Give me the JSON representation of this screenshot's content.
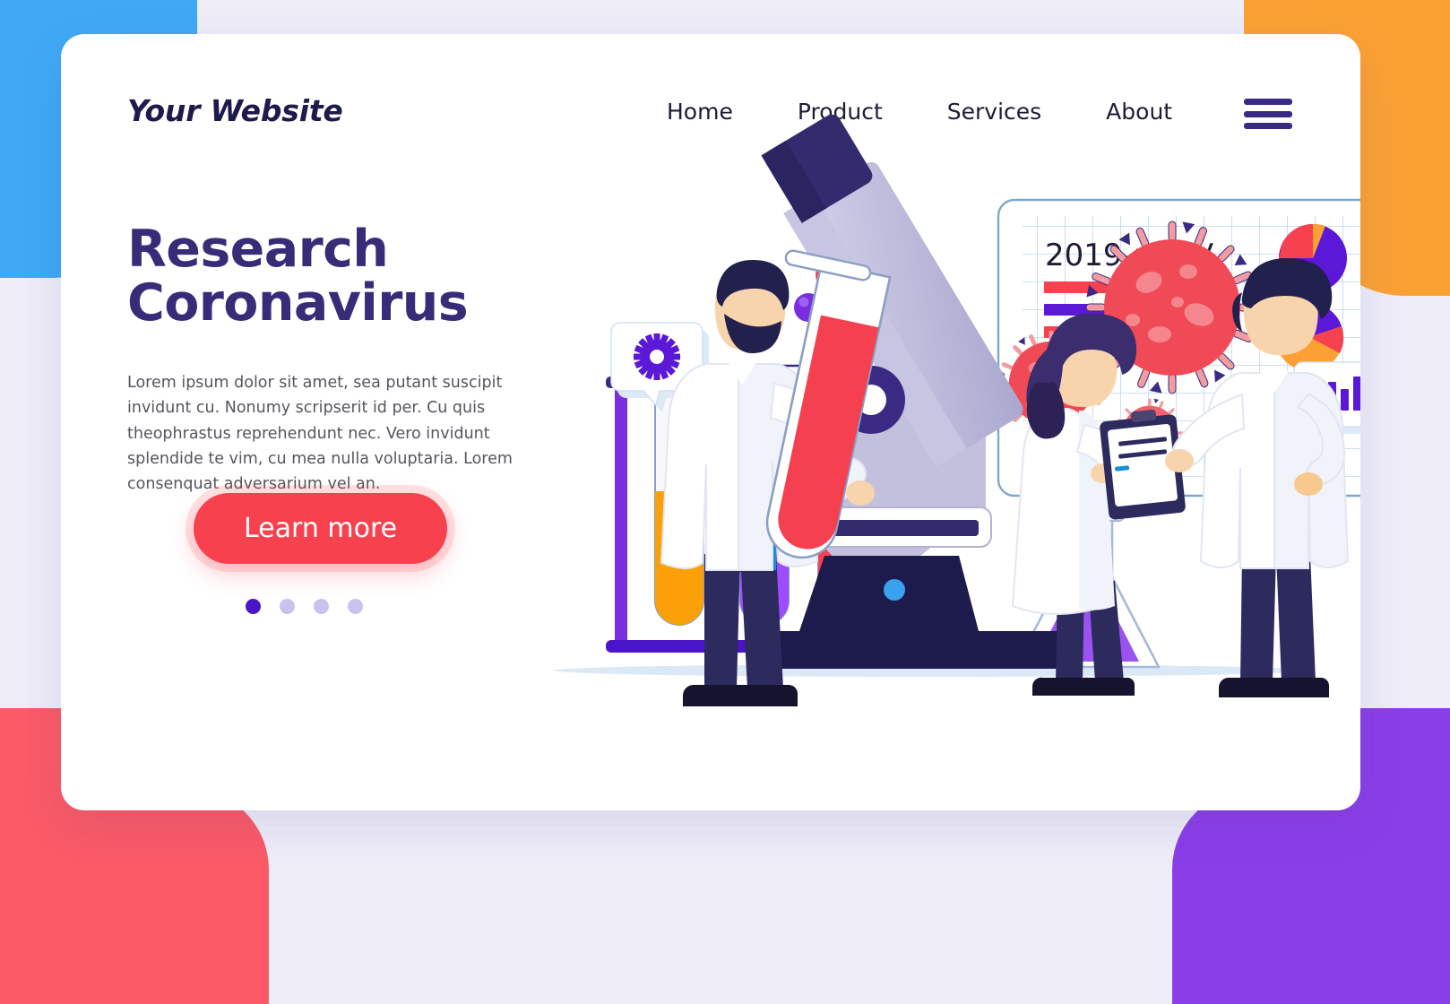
{
  "page": {
    "background_color": "#eeedf8",
    "card_color": "#ffffff"
  },
  "decor": {
    "top_left_color": "#3fa9f5",
    "top_right_color": "#fba134",
    "bottom_left_color": "#fb5a66",
    "bottom_right_color": "#8a3ee8"
  },
  "header": {
    "logo": "Your Website",
    "nav": [
      {
        "label": "Home"
      },
      {
        "label": "Product"
      },
      {
        "label": "Services"
      },
      {
        "label": "About"
      }
    ],
    "menu_icon": "hamburger-menu-icon",
    "menu_color": "#3a2a83"
  },
  "hero": {
    "title_line1": "Research",
    "title_line2": "Coronavirus",
    "title_color": "#382c79",
    "body": "Lorem ipsum dolor sit amet, sea putant suscipit invidunt cu. Nonumy scripserit id per. Cu quis theophrastus reprehendunt nec. Vero invidunt splendide te vim, cu mea nulla voluptaria. Lorem consenquat adversarium vel an.",
    "cta_label": "Learn more",
    "cta_color": "#f8414f",
    "carousel": {
      "count": 4,
      "active_index": 0,
      "active_color": "#4a14c8",
      "inactive_color": "#c9c2ef"
    }
  },
  "illustration": {
    "name": "coronavirus-research-lab-illustration",
    "board": {
      "title": "2019-nCoV",
      "title_color": "#1d1b35",
      "grid_color": "#bcd6ef",
      "bars": [
        {
          "color": "#f8414f",
          "length": 200
        },
        {
          "color": "#5b18d6",
          "length": 160
        },
        {
          "color": "#f8414f",
          "length": 88
        },
        {
          "color": "#5b18d6",
          "length": 130
        }
      ],
      "pie_charts": [
        {
          "name": "pie-chart-top",
          "slices": [
            {
              "color": "#5b18d6",
              "value": 58
            },
            {
              "color": "#f8414f",
              "value": 30
            },
            {
              "color": "#fba134",
              "value": 12
            }
          ]
        },
        {
          "name": "pie-chart-bottom",
          "slices": [
            {
              "color": "#fba134",
              "value": 62
            },
            {
              "color": "#5b18d6",
              "value": 26
            },
            {
              "color": "#f8414f",
              "value": 12
            }
          ]
        }
      ]
    },
    "speech_bubbles": [
      {
        "name": "gear-bubble",
        "icon": "gear-icon",
        "icon_color": "#5b18d6"
      },
      {
        "name": "chart-bubble",
        "icon": "bar-chart-icon",
        "icon_color": "#5b18d6"
      }
    ],
    "test_tubes": [
      {
        "name": "test-tube-orange",
        "color": "#fba007"
      },
      {
        "name": "test-tube-purple",
        "color": "#9b4dff"
      },
      {
        "name": "test-tube-red",
        "color": "#f5414f"
      }
    ],
    "rack_color": "#7a2ee0",
    "flask": {
      "name": "erlenmeyer-flask",
      "liquid_color": "#9a53f0"
    },
    "microscope": {
      "body_color": "#b8b5d8",
      "eyepiece_color": "#322b6e",
      "base_color": "#1d1b4b",
      "knob_color": "#4a14c8"
    },
    "viruses": [
      {
        "name": "virus-large",
        "color": "#f04a56"
      },
      {
        "name": "virus-medium",
        "color": "#f04a56"
      },
      {
        "name": "virus-small",
        "color": "#f4616c"
      }
    ],
    "molecules": [
      {
        "name": "molecule-red-large",
        "color": "#f8414f"
      },
      {
        "name": "molecule-purple",
        "color": "#7a2ee0"
      },
      {
        "name": "molecule-orange",
        "color": "#fba134"
      },
      {
        "name": "molecule-red-small",
        "color": "#f8414f"
      }
    ],
    "people": [
      {
        "name": "scientist-with-test-tube",
        "coat": "#ffffff",
        "shirt": "#1b8fd6",
        "pants": "#2d2a5e",
        "hair": "#22204c"
      },
      {
        "name": "scientist-with-clipboard",
        "coat": "#ffffff",
        "pants": "#2d2a5e",
        "hair": "#3b2d6e"
      },
      {
        "name": "scientist-standing",
        "coat": "#ffffff",
        "shirt": "#1b8fd6",
        "pants": "#2d2a5e",
        "hair": "#22204c"
      }
    ]
  }
}
